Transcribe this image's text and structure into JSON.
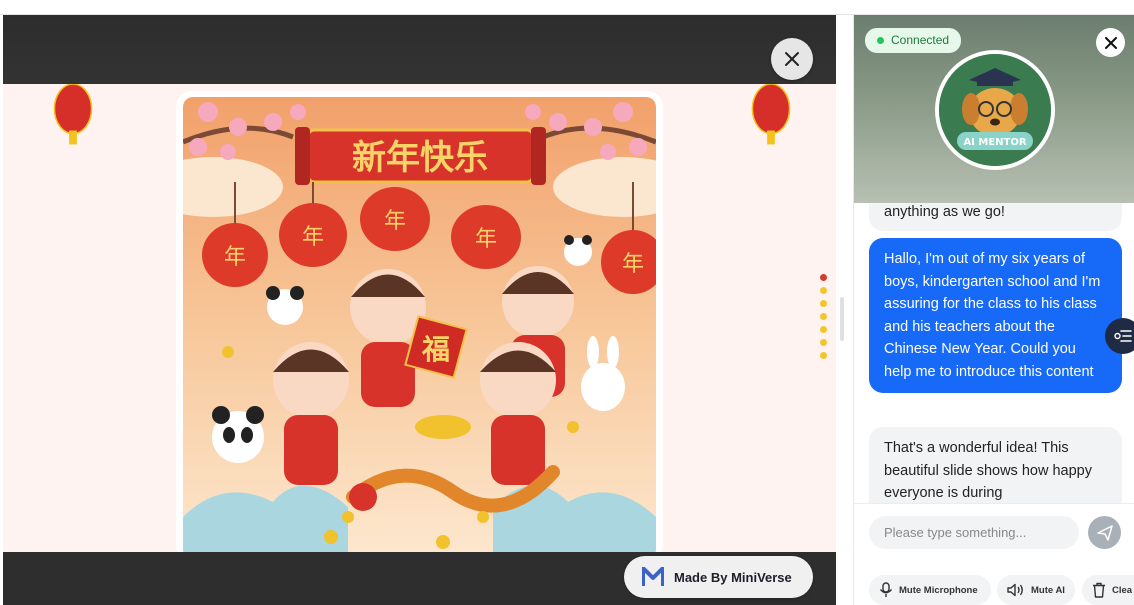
{
  "viewer": {
    "made_by_label": "Made By MiniVerse",
    "slide_title_chars": "新年快乐",
    "fu_char": "福",
    "lantern_char": "年",
    "pager_colors": [
      "#d23c2c",
      "#f3c52b",
      "#f3c52b",
      "#f3c52b",
      "#f3c52b",
      "#f3c52b",
      "#f3c52b"
    ]
  },
  "panel": {
    "status": "Connected",
    "avatar_text": "AI MENTOR",
    "messages": [
      {
        "role": "ai",
        "text": "anything as we go!"
      },
      {
        "role": "user",
        "text": "Hallo, I'm out of my six years of boys, kindergarten school and I'm assuring for the class to his class and his teachers about the Chinese New Year. Could you help me to introduce this content"
      },
      {
        "role": "ai",
        "text": "That's a wonderful idea! This beautiful slide shows how happy everyone is during"
      }
    ],
    "input_placeholder": "Please type something...",
    "controls": {
      "mute_mic": "Mute Microphone",
      "mute_ai": "Mute AI",
      "clear": "Clea"
    }
  },
  "colors": {
    "accent_blue": "#1769f7",
    "connected_green": "#27c259",
    "lantern_red": "#d62f2a"
  }
}
